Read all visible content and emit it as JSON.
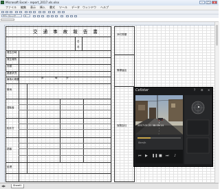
{
  "window": {
    "title": "Microsoft Excel - report_2017.xls.xlsx",
    "minimize": "–",
    "maximize": "□",
    "close": "✕"
  },
  "menu": {
    "items": [
      "ファイル",
      "編集",
      "表示",
      "挿入",
      "書式",
      "ツール",
      "データ",
      "ウィンドウ",
      "ヘルプ"
    ]
  },
  "toolbar": {
    "font_name": "ＭＳ ゴシック",
    "font_size": "9"
  },
  "form": {
    "title": "交 通 事 故 報 告 書",
    "labels": [
      "発生日時",
      "発生場所",
      "天候",
      "路面状況",
      "事故の概要",
      "車両",
      "運転者",
      "相手方",
      "損害",
      "処理"
    ],
    "small_labels": [
      "日",
      "月",
      "年",
      "時",
      "分"
    ],
    "right_labels": [
      "添付書類",
      "警察届出",
      "保険会社"
    ]
  },
  "player": {
    "logo": "Cellstar",
    "timestamp": "2017.01.21 08:05:14",
    "speed_readout": "0km/h"
  },
  "sheet_tabs": [
    "Sheet1"
  ],
  "colors": {
    "grid": "#e2e2e2",
    "title_bar": "#d7e3f3",
    "player_bg": "#1b1c1e"
  }
}
